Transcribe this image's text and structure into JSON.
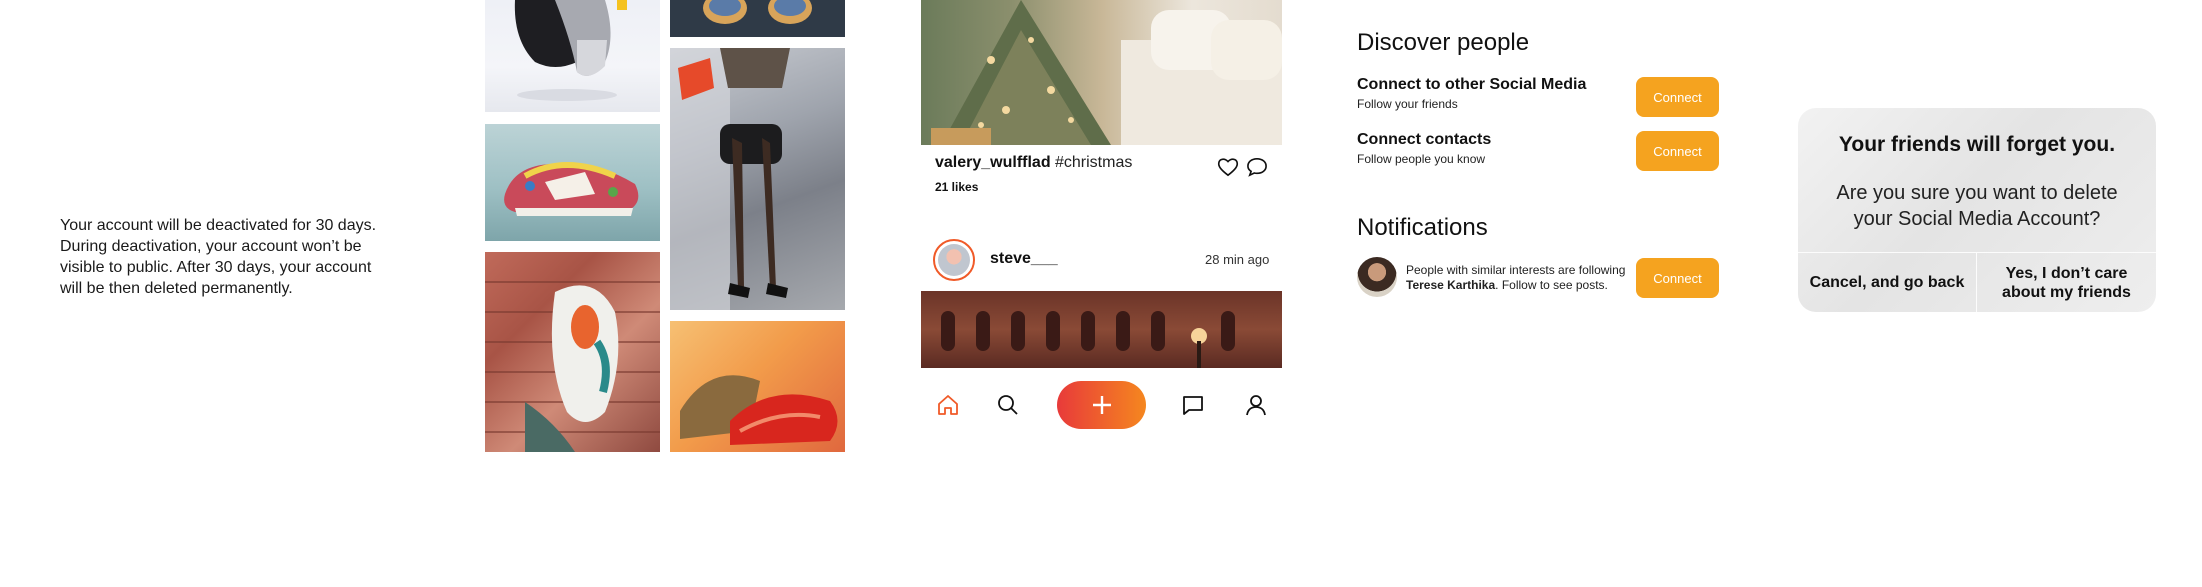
{
  "deactivation": {
    "text": "Your account will be deactivated for 30 days.\nDuring deactivation, your account won’t be\nvisible to public. After 30 days, your account\nwill be then deleted permanently."
  },
  "gallery": {
    "tiles": [
      "sneaker-hanging-photo",
      "shoes-top-photo",
      "woman-heels-handbag-photo",
      "floral-sneaker-photo",
      "sneaker-on-brick-wall-photo",
      "red-sneakers-photo"
    ]
  },
  "feed": {
    "post1": {
      "username": "valery_wulfflad",
      "hashtag": "#christmas",
      "likes": "21 likes"
    },
    "post2": {
      "username": "steve___",
      "time": "28 min ago"
    },
    "nav": {
      "icons": [
        "home-icon",
        "search-icon",
        "plus-icon",
        "chat-icon",
        "profile-icon"
      ]
    },
    "accent": "#f05a28"
  },
  "discover": {
    "title": "Discover people",
    "rows": [
      {
        "title": "Connect to other Social Media",
        "subtitle": "Follow your friends",
        "button": "Connect"
      },
      {
        "title": "Connect contacts",
        "subtitle": "Follow people you know",
        "button": "Connect"
      }
    ],
    "accent": "#f5a31f"
  },
  "notifications": {
    "title": "Notifications",
    "item": {
      "text_before": "People with similar interests are following",
      "name": "Terese Karthika",
      "text_after": ". Follow to see posts.",
      "button": "Connect"
    }
  },
  "dialog": {
    "title": "Your friends will forget you.",
    "body": "Are you sure you want to delete your Social Media Account?",
    "cancel": "Cancel, and go back",
    "confirm": "Yes, I don’t care about my friends"
  }
}
